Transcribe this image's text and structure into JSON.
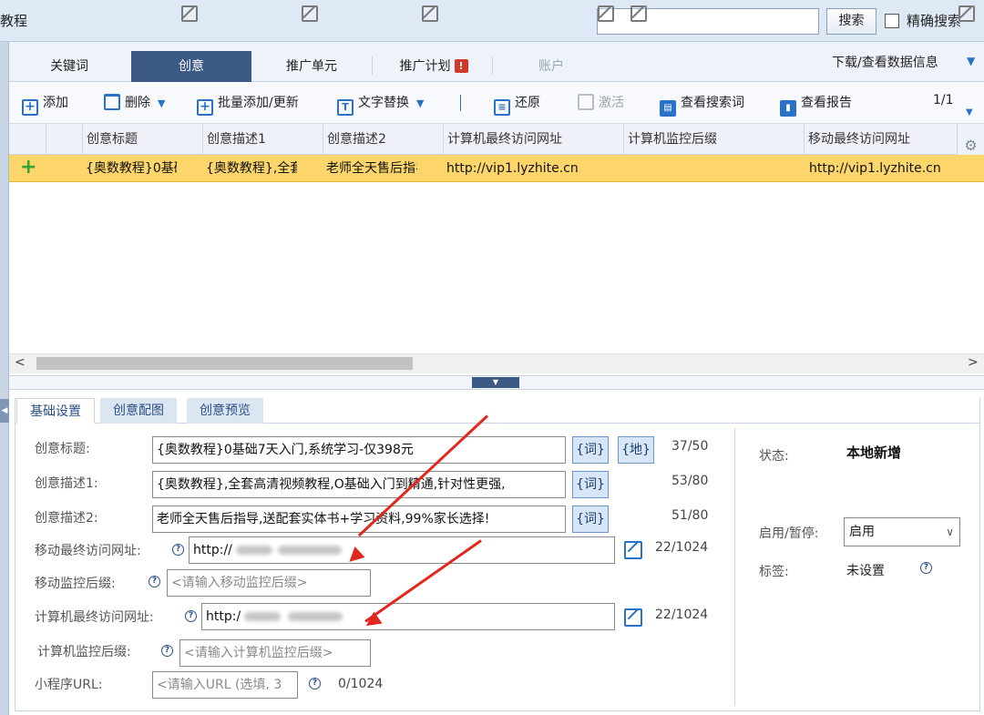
{
  "window": {
    "title": "教程"
  },
  "search": {
    "button_label": "搜索",
    "exact_label": "精确搜索",
    "value": ""
  },
  "tabs": [
    {
      "label": "关键词"
    },
    {
      "label": "创意"
    },
    {
      "label": "推广单元"
    },
    {
      "label": "推广计划"
    },
    {
      "label": "账户"
    }
  ],
  "download_label": "下载/查看数据信息",
  "toolbar": {
    "add": "添加",
    "delete": "删除",
    "batch": "批量添加/更新",
    "replace": "文字替换",
    "restore": "还原",
    "activate": "激活",
    "search_terms": "查看搜索词",
    "report": "查看报告",
    "page": "1/1"
  },
  "grid": {
    "columns": [
      "创意标题",
      "创意描述1",
      "创意描述2",
      "计算机最终访问网址",
      "计算机监控后缀",
      "移动最终访问网址"
    ],
    "row": {
      "title": "{奥数教程}0基础7天入门,系统学习-仅398元",
      "desc1": "{奥数教程},全套高清视频教程,O基础入门到精通,针对性更强,",
      "desc2": "老师全天售后指导,送配套实体书+学习资料,99%家长选择!",
      "pc_url": "http://vip1.lyzhite.cn",
      "pc_suffix": "",
      "mobile_url": "http://vip1.lyzhite.cn"
    }
  },
  "panel": {
    "tabs": [
      "基础设置",
      "创意配图",
      "创意预览"
    ],
    "labels": {
      "title": "创意标题:",
      "desc1": "创意描述1:",
      "desc2": "创意描述2:",
      "mobile_url": "移动最终访问网址:",
      "mobile_suffix": "移动监控后缀:",
      "pc_url": "计算机最终访问网址:",
      "pc_suffix": "计算机监控后缀:",
      "mini_url": "小程序URL:"
    },
    "values": {
      "title": "{奥数教程}0基础7天入门,系统学习-仅398元",
      "desc1": "{奥数教程},全套高清视频教程,O基础入门到精通,针对性更强,",
      "desc2": "老师全天售后指导,送配套实体书+学习资料,99%家长选择!",
      "mobile_url": "http://",
      "pc_url": "http:/"
    },
    "placeholders": {
      "mobile_suffix": "<请输入移动监控后缀>",
      "pc_suffix": "<请输入计算机监控后缀>",
      "mini_url": "<请输入URL (选填, 3"
    },
    "buttons": {
      "word": "{词}",
      "region": "{地}"
    },
    "counters": {
      "title": "37/50",
      "desc1": "53/80",
      "desc2": "51/80",
      "mobile_url": "22/1024",
      "pc_url": "22/1024",
      "mini_url": "0/1024"
    },
    "right": {
      "status_label": "状态:",
      "status_value": "本地新增",
      "enable_label": "启用/暂停:",
      "enable_value": "启用",
      "tag_label": "标签:",
      "tag_value": "未设置"
    }
  },
  "colors": {
    "accent": "#2a72c8",
    "active_tab": "#3d5a86",
    "row_highlight": "#fcd66b",
    "arrow": "#e0281f"
  }
}
